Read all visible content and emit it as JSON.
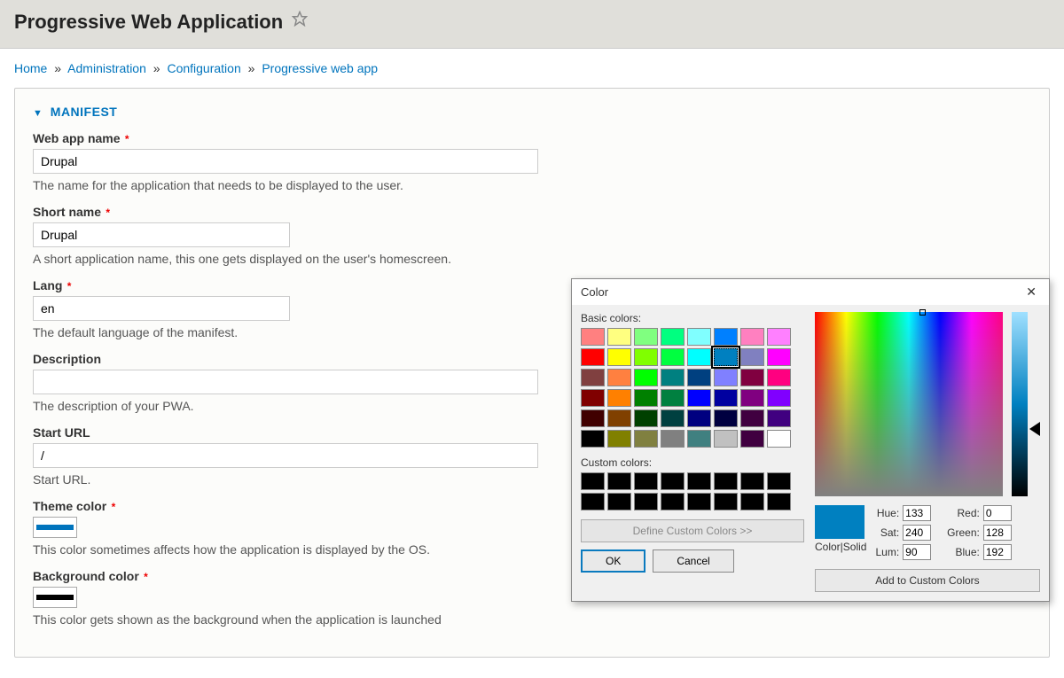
{
  "header": {
    "title": "Progressive Web Application"
  },
  "breadcrumb": [
    {
      "label": "Home"
    },
    {
      "label": "Administration"
    },
    {
      "label": "Configuration"
    },
    {
      "label": "Progressive web app"
    }
  ],
  "section": {
    "title": "MANIFEST"
  },
  "fields": {
    "name": {
      "label": "Web app name",
      "value": "Drupal",
      "desc": "The name for the application that needs to be displayed to the user.",
      "required": true
    },
    "short_name": {
      "label": "Short name",
      "value": "Drupal",
      "desc": "A short application name, this one gets displayed on the user's homescreen.",
      "required": true
    },
    "lang": {
      "label": "Lang",
      "value": "en",
      "desc": "The default language of the manifest.",
      "required": true
    },
    "description": {
      "label": "Description",
      "value": "",
      "desc": "The description of your PWA."
    },
    "start_url": {
      "label": "Start URL",
      "value": "/",
      "desc": "Start URL."
    },
    "theme_color": {
      "label": "Theme color",
      "desc": "This color sometimes affects how the application is displayed by the OS.",
      "required": true
    },
    "bg_color": {
      "label": "Background color",
      "desc": "This color gets shown as the background when the application is launched",
      "required": true
    }
  },
  "color_dialog": {
    "title": "Color",
    "basic_label": "Basic colors:",
    "custom_label": "Custom colors:",
    "define_label": "Define Custom Colors >>",
    "ok": "OK",
    "cancel": "Cancel",
    "color_solid": "Color|Solid",
    "add_custom": "Add to Custom Colors",
    "hsl": {
      "hue_label": "Hue:",
      "hue": "133",
      "sat_label": "Sat:",
      "sat": "240",
      "lum_label": "Lum:",
      "lum": "90"
    },
    "rgb": {
      "red_label": "Red:",
      "red": "0",
      "green_label": "Green:",
      "green": "128",
      "blue_label": "Blue:",
      "blue": "192"
    },
    "basic_colors": [
      "#ff8080",
      "#ffff80",
      "#80ff80",
      "#00ff80",
      "#80ffff",
      "#0080ff",
      "#ff80c0",
      "#ff80ff",
      "#ff0000",
      "#ffff00",
      "#80ff00",
      "#00ff40",
      "#00ffff",
      "#0080c0",
      "#8080c0",
      "#ff00ff",
      "#804040",
      "#ff8040",
      "#00ff00",
      "#008080",
      "#004080",
      "#8080ff",
      "#800040",
      "#ff0080",
      "#800000",
      "#ff8000",
      "#008000",
      "#008040",
      "#0000ff",
      "#0000a0",
      "#800080",
      "#8000ff",
      "#400000",
      "#804000",
      "#004000",
      "#004040",
      "#000080",
      "#000040",
      "#400040",
      "#400080",
      "#000000",
      "#808000",
      "#808040",
      "#808080",
      "#408080",
      "#c0c0c0",
      "#400040",
      "#ffffff"
    ],
    "selected_index": 13,
    "custom_colors": [
      "#000000",
      "#000000",
      "#000000",
      "#000000",
      "#000000",
      "#000000",
      "#000000",
      "#000000",
      "#000000",
      "#000000",
      "#000000",
      "#000000",
      "#000000",
      "#000000",
      "#000000",
      "#000000"
    ]
  }
}
